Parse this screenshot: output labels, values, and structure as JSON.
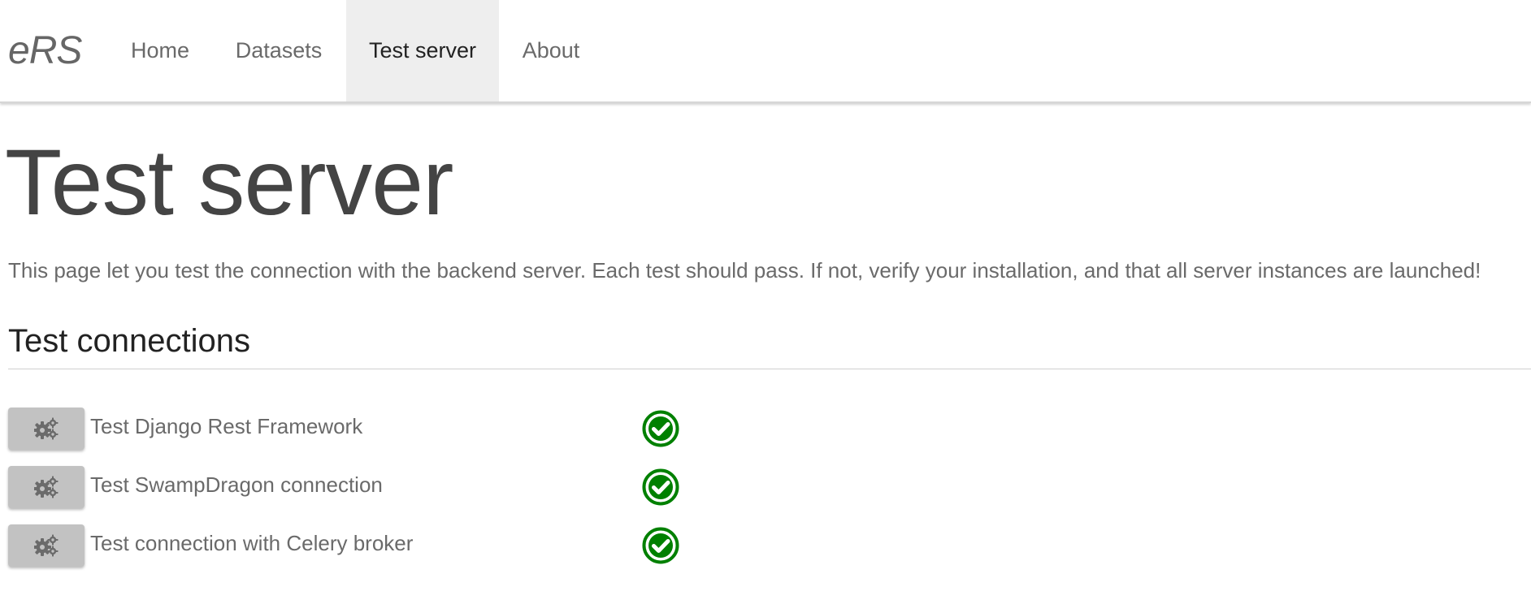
{
  "nav": {
    "brand": "eRS",
    "items": [
      {
        "label": "Home",
        "active": false
      },
      {
        "label": "Datasets",
        "active": false
      },
      {
        "label": "Test server",
        "active": true
      },
      {
        "label": "About",
        "active": false
      }
    ]
  },
  "page": {
    "title": "Test server",
    "intro": "This page let you test the connection with the backend server. Each test should pass. If not, verify your installation, and that all server instances are launched!"
  },
  "section": {
    "title": "Test connections"
  },
  "tests": [
    {
      "label": "Test Django Rest Framework",
      "button_icon": "gears-icon",
      "status": "passed",
      "status_icon": "check-circle-icon"
    },
    {
      "label": "Test SwampDragon connection",
      "button_icon": "gears-icon",
      "status": "passed",
      "status_icon": "check-circle-icon"
    },
    {
      "label": "Test connection with Celery broker",
      "button_icon": "gears-icon",
      "status": "passed",
      "status_icon": "check-circle-icon"
    }
  ],
  "colors": {
    "success": "#008000",
    "button": "#c2c2c2",
    "active_nav_bg": "#eeeeee"
  }
}
